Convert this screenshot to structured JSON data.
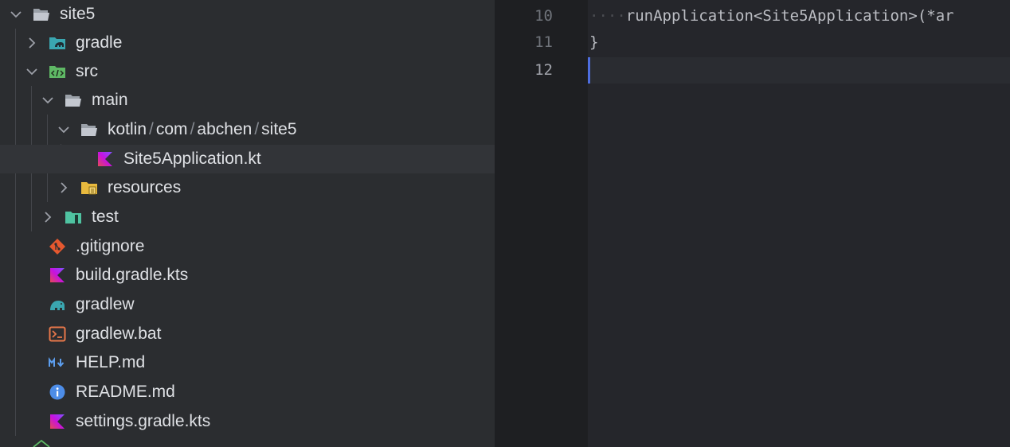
{
  "tree": {
    "rows": [
      {
        "label": "site5",
        "icon": "folder-open-icon"
      },
      {
        "label": "gradle",
        "icon": "gradle-folder-icon"
      },
      {
        "label": "src",
        "icon": "source-folder-icon"
      },
      {
        "label": "main",
        "icon": "folder-open-icon"
      },
      {
        "path": [
          "kotlin",
          "com",
          "abchen",
          "site5"
        ],
        "icon": "folder-open-icon"
      },
      {
        "label": "Site5Application.kt",
        "icon": "kotlin-file-icon"
      },
      {
        "label": "resources",
        "icon": "resources-folder-icon"
      },
      {
        "label": "test",
        "icon": "test-folder-icon"
      },
      {
        "label": ".gitignore",
        "icon": "git-icon"
      },
      {
        "label": "build.gradle.kts",
        "icon": "kotlin-file-icon"
      },
      {
        "label": "gradlew",
        "icon": "gradle-elephant-icon"
      },
      {
        "label": "gradlew.bat",
        "icon": "terminal-icon"
      },
      {
        "label": "HELP.md",
        "icon": "markdown-icon"
      },
      {
        "label": "README.md",
        "icon": "info-icon"
      },
      {
        "label": "settings.gradle.kts",
        "icon": "kotlin-file-icon"
      }
    ],
    "path_separator": "/"
  },
  "editor": {
    "lines": [
      {
        "number": "10",
        "indent": "····",
        "text": "runApplication<Site5Application>(*ar"
      },
      {
        "number": "11",
        "indent": "",
        "text": "}"
      },
      {
        "number": "12",
        "indent": "",
        "text": ""
      }
    ],
    "current_line": "12"
  },
  "colors": {
    "tree_bg": "#2b2d30",
    "editor_bg": "#1e1f22",
    "selection": "#323438",
    "caret": "#4e6ee0",
    "text": "#dfe1e5"
  }
}
